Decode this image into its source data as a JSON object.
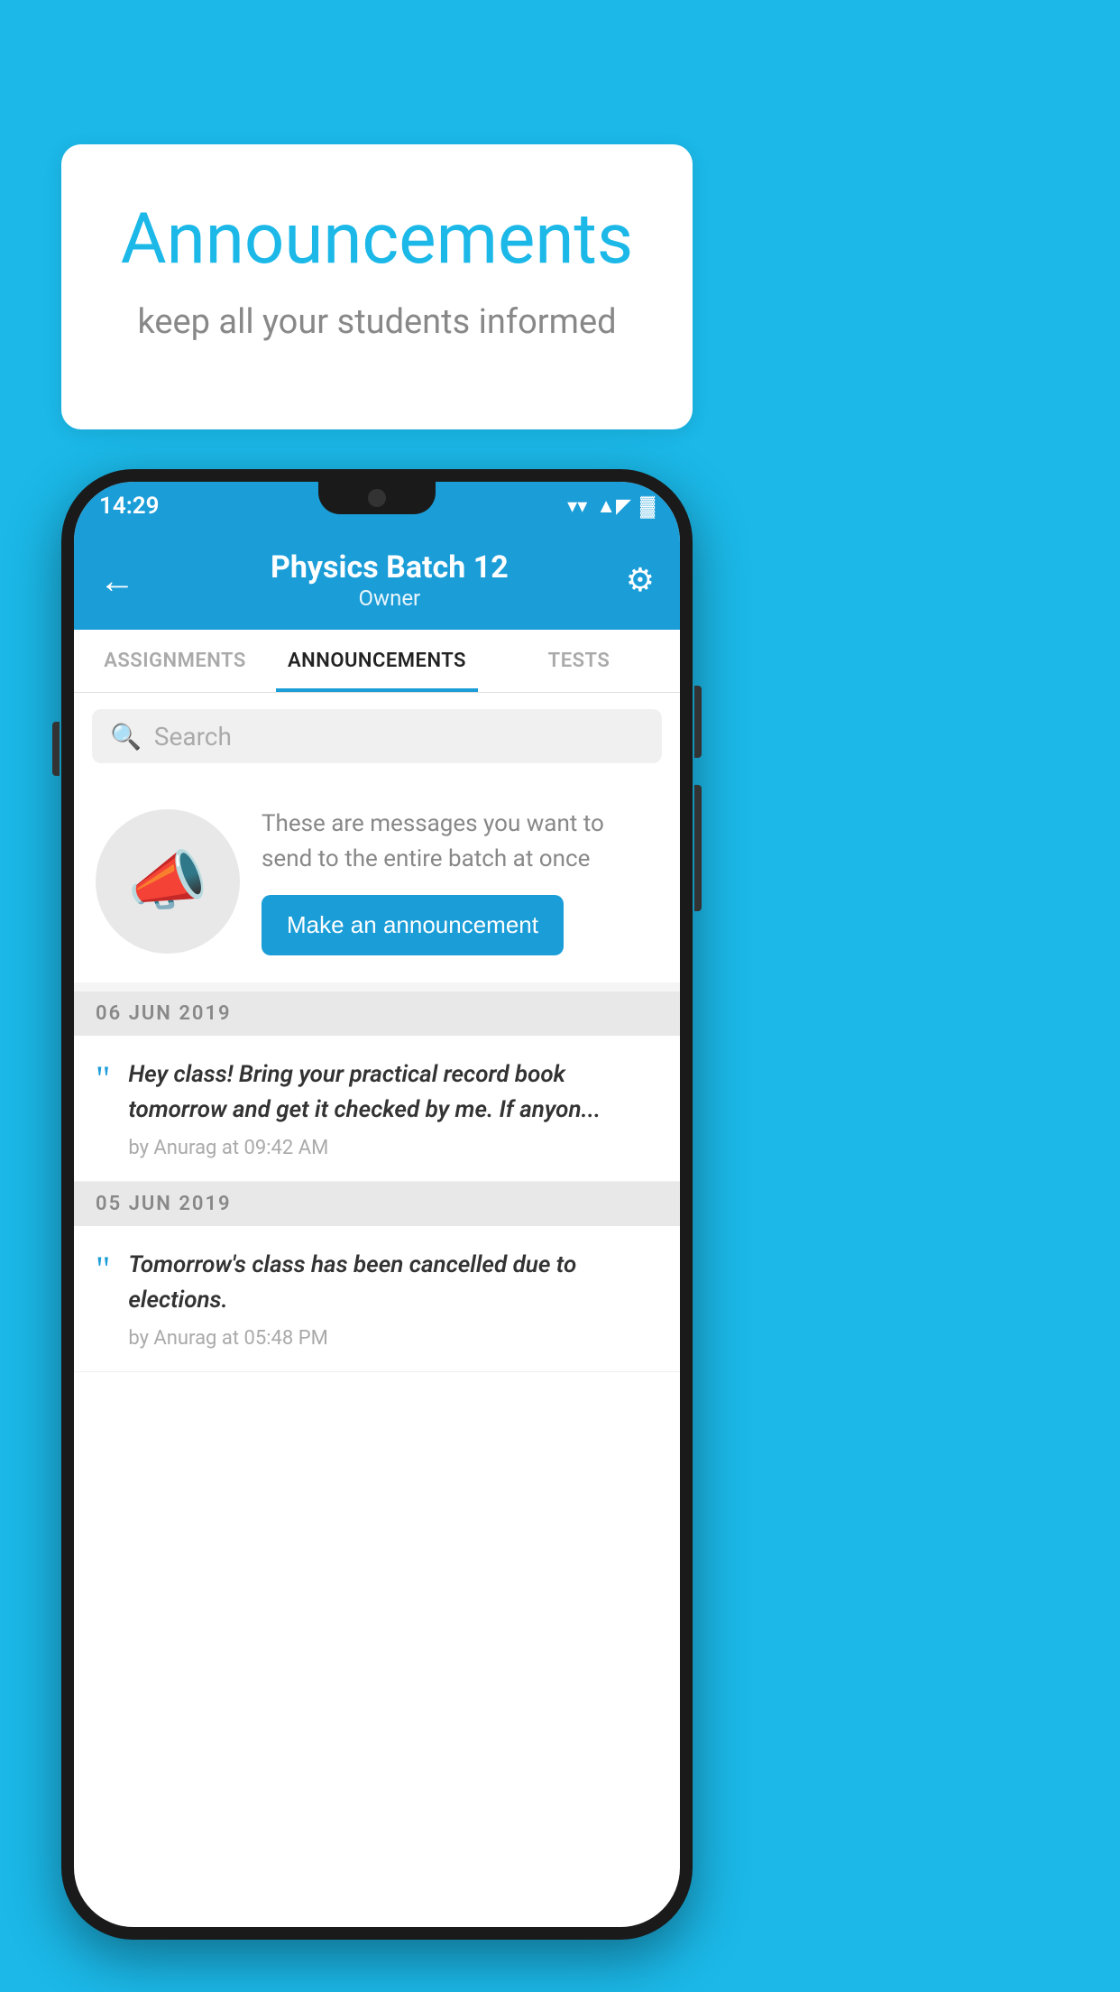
{
  "page": {
    "background_color": "#1BB8E8"
  },
  "speech_bubble": {
    "title": "Announcements",
    "subtitle": "keep all your students informed"
  },
  "phone": {
    "status_bar": {
      "time": "14:29",
      "wifi": "▼",
      "signal": "▲",
      "battery": "▌"
    },
    "header": {
      "title": "Physics Batch 12",
      "subtitle": "Owner",
      "back_label": "←",
      "gear_label": "⚙"
    },
    "tabs": [
      {
        "label": "ASSIGNMENTS",
        "active": false
      },
      {
        "label": "ANNOUNCEMENTS",
        "active": true
      },
      {
        "label": "TESTS",
        "active": false
      }
    ],
    "search": {
      "placeholder": "Search"
    },
    "promo": {
      "description": "These are messages you want to send to the entire batch at once",
      "button_label": "Make an announcement"
    },
    "announcements": [
      {
        "date": "06  JUN  2019",
        "text": "Hey class! Bring your practical record book tomorrow and get it checked by me. If anyon...",
        "meta": "by Anurag at 09:42 AM"
      },
      {
        "date": "05  JUN  2019",
        "text": "Tomorrow's class has been cancelled due to elections.",
        "meta": "by Anurag at 05:48 PM"
      }
    ]
  }
}
